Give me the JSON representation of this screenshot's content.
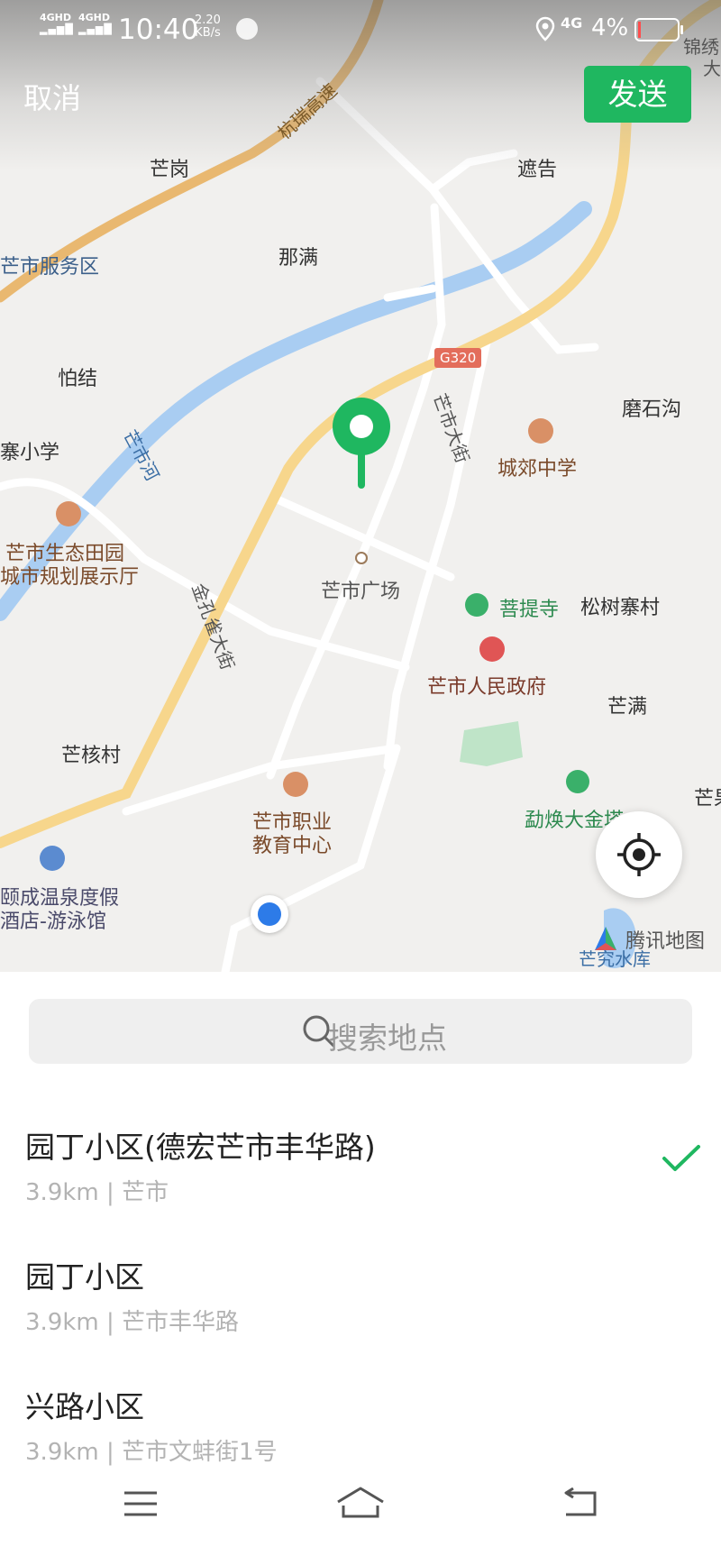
{
  "status_bar": {
    "signal_1": "4GHD",
    "signal_2": "4GHD",
    "time": "10:40",
    "speed_value": "2.20",
    "speed_unit": "KB/s",
    "network": "4G",
    "battery": "4%"
  },
  "header": {
    "cancel_label": "取消",
    "send_label": "发送",
    "send_color": "#1fb760"
  },
  "map": {
    "labels": {
      "road_hangrui": "杭瑞高速",
      "mang_gang": "芒岗",
      "zhe_gao": "遮告",
      "service_area": "芒市服务区",
      "na_man": "那满",
      "pa_jie": "怕结",
      "g320": "G320",
      "moshigou": "磨石沟",
      "mangshi_river": "芒市河",
      "school_left": "寨小学",
      "mangshi_street": "芒市大街",
      "chengjiao_school": "城郊中学",
      "eco_garden": "芒市生态田园",
      "planning_hall": "城市规划展示厅",
      "square": "芒市广场",
      "puti_temple": "菩提寺",
      "songshuzhai": "松树寨村",
      "peacock_street": "金孔雀大街",
      "gov": "芒市人民政府",
      "mang_man": "芒满",
      "mang_he": "芒核村",
      "mianhuan": "勐焕大金塔",
      "mang_right": "芒果",
      "vocational_1": "芒市职业",
      "vocational_2": "教育中心",
      "hotspring_1": "颐成温泉度假",
      "hotspring_2": "酒店-游泳馆",
      "reservoir": "芒究水库",
      "corner_1": "锦绣",
      "corner_2": "大"
    },
    "brand": "腾讯地图"
  },
  "search": {
    "placeholder": "搜索地点"
  },
  "results": [
    {
      "name": "园丁小区(德宏芒市丰华路)",
      "sub": "3.9km | 芒市",
      "selected": true
    },
    {
      "name": "园丁小区",
      "sub": "3.9km | 芒市丰华路",
      "selected": false
    },
    {
      "name": "兴路小区",
      "sub": "3.9km | 芒市文蚌街1号",
      "selected": false
    }
  ]
}
